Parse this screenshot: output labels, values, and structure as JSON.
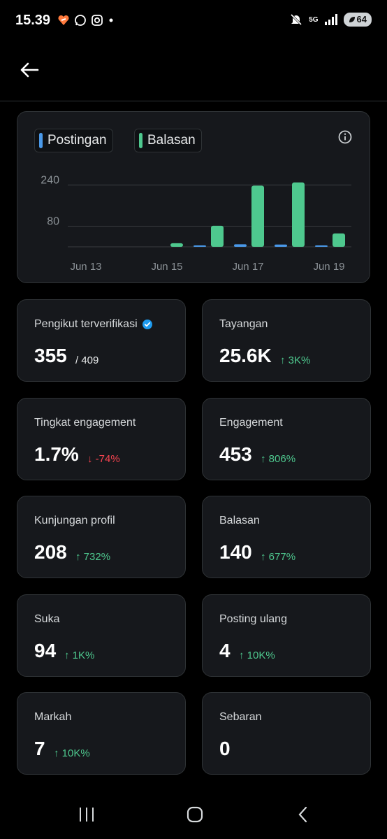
{
  "status_bar": {
    "time": "15.39",
    "battery": "64",
    "network": "5G"
  },
  "header": {
    "back_icon": "arrow-left-icon"
  },
  "chart": {
    "legend": [
      {
        "label": "Postingan",
        "color": "#4a99e9"
      },
      {
        "label": "Balasan",
        "color": "#4ec88e"
      }
    ],
    "info_icon": "info-icon"
  },
  "chart_data": {
    "type": "bar",
    "categories": [
      "Jun 13",
      "Jun 14",
      "Jun 15",
      "Jun 16",
      "Jun 17",
      "Jun 18",
      "Jun 19"
    ],
    "x_tick_labels": [
      "Jun 13",
      "Jun 15",
      "Jun 17",
      "Jun 19"
    ],
    "y_tick_labels": [
      80,
      240
    ],
    "ylim": [
      0,
      280
    ],
    "series": [
      {
        "name": "Postingan",
        "color": "#4a99e9",
        "values": [
          0,
          0,
          0,
          3,
          10,
          9,
          4
        ]
      },
      {
        "name": "Balasan",
        "color": "#4ec88e",
        "values": [
          0,
          0,
          14,
          82,
          238,
          250,
          52
        ]
      }
    ],
    "grid": true,
    "legend_position": "top-left"
  },
  "stats": [
    {
      "label": "Pengikut terverifikasi",
      "value": "355",
      "extra": "/ 409",
      "extra_type": "muted",
      "verified_icon": "verified-badge-icon"
    },
    {
      "label": "Tayangan",
      "value": "25.6K",
      "extra": "↑ 3K%",
      "extra_type": "pos"
    },
    {
      "label": "Tingkat engagement",
      "value": "1.7%",
      "extra": "↓ -74%",
      "extra_type": "neg"
    },
    {
      "label": "Engagement",
      "value": "453",
      "extra": "↑ 806%",
      "extra_type": "pos"
    },
    {
      "label": "Kunjungan profil",
      "value": "208",
      "extra": "↑ 732%",
      "extra_type": "pos"
    },
    {
      "label": "Balasan",
      "value": "140",
      "extra": "↑ 677%",
      "extra_type": "pos"
    },
    {
      "label": "Suka",
      "value": "94",
      "extra": "↑ 1K%",
      "extra_type": "pos"
    },
    {
      "label": "Posting ulang",
      "value": "4",
      "extra": "↑ 10K%",
      "extra_type": "pos"
    },
    {
      "label": "Markah",
      "value": "7",
      "extra": "↑ 10K%",
      "extra_type": "pos"
    },
    {
      "label": "Sebaran",
      "value": "0",
      "extra": "",
      "extra_type": "pos"
    }
  ],
  "nav_bar": {
    "recents_icon": "recents-icon",
    "home_icon": "home-icon",
    "back_icon": "back-chevron-icon"
  }
}
